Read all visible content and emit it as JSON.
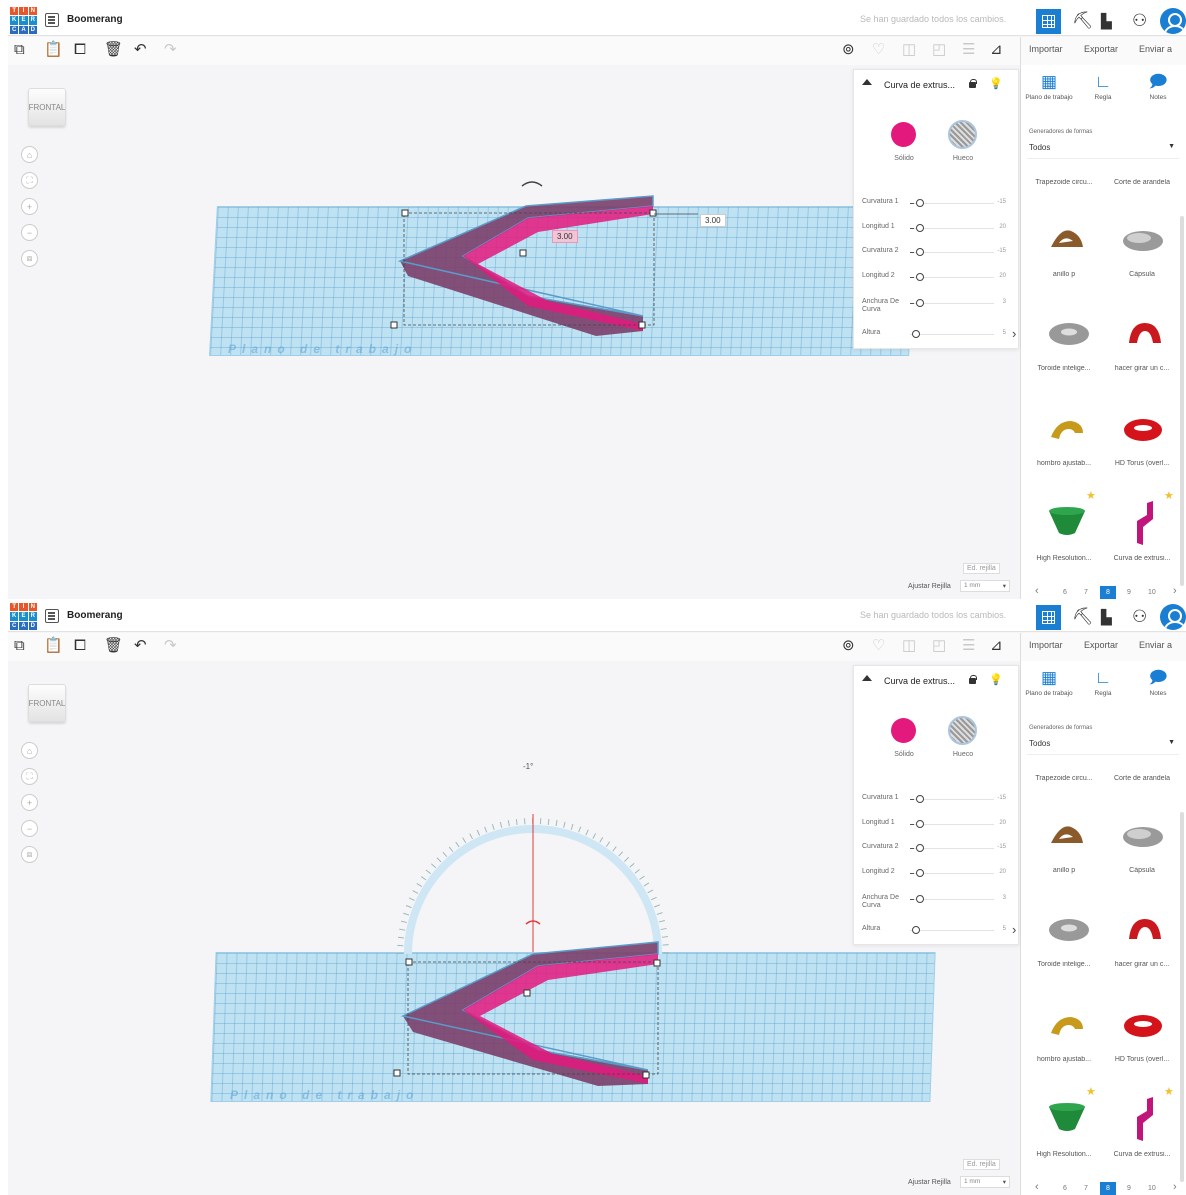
{
  "app": {
    "project_title": "Boomerang",
    "saved_status": "Se han guardado todos los cambios.",
    "logo_letters": [
      "T",
      "I",
      "N",
      "K",
      "E",
      "R",
      "C",
      "A",
      "D"
    ]
  },
  "toolbar": {
    "import_label": "Importar",
    "export_label": "Exportar",
    "send_label": "Enviar a"
  },
  "viewport": {
    "view_cube_label": "FRONTAL",
    "workplane_label": "Plano de trabajo",
    "dim_width": "3.00",
    "dim_height": "3.00",
    "rotation_value": "-1°"
  },
  "inspector": {
    "title": "Curva de extrus...",
    "solid_label": "Sólido",
    "hole_label": "Hueco",
    "params": [
      {
        "label": "Curvatura 1",
        "value": "-15",
        "level": 0.05
      },
      {
        "label": "Longitud 1",
        "value": "20",
        "level": 0.05
      },
      {
        "label": "Curvatura 2",
        "value": "-15",
        "level": 0.05
      },
      {
        "label": "Longitud 2",
        "value": "20",
        "level": 0.05
      },
      {
        "label": "Anchura De Curva",
        "value": "3",
        "level": 0.05
      },
      {
        "label": "Altura",
        "value": "5",
        "level": 0.0
      }
    ],
    "collapse_arrow": "›"
  },
  "grid": {
    "edit_grid_label": "Ed. rejilla",
    "snap_label": "Ajustar Rejilla",
    "snap_value": "1 mm"
  },
  "right_panel": {
    "workplane_btn": "Plano de trabajo",
    "ruler_btn": "Regla",
    "notes_btn": "Notes",
    "generators_label": "Generadores de formas",
    "generators_value": "Todos",
    "header_shapes": [
      "Trapezoide circu...",
      "Corte de arandela"
    ],
    "shapes": [
      {
        "name": "anillo p",
        "icon": "ring-shape-icon"
      },
      {
        "name": "Cápsula",
        "icon": "capsule-shape-icon"
      },
      {
        "name": "Toroide intelige...",
        "icon": "torus-shape-icon"
      },
      {
        "name": "hacer girar un c...",
        "icon": "spin-shape-icon"
      },
      {
        "name": "hombro ajustab...",
        "icon": "shoulder-shape-icon"
      },
      {
        "name": "HD Torus (overl...",
        "icon": "hd-torus-shape-icon"
      },
      {
        "name": "High Resolution...",
        "icon": "high-res-shape-icon"
      },
      {
        "name": "Curva de extrusi...",
        "icon": "extrusion-curve-shape-icon"
      }
    ],
    "pages": [
      "6",
      "7",
      "8",
      "9",
      "10"
    ],
    "active_page": "8",
    "prev": "‹",
    "next": "›"
  },
  "colors": {
    "accent": "#1a7ed3",
    "solid": "#e4197e",
    "workplane": "#bfe2f3"
  }
}
